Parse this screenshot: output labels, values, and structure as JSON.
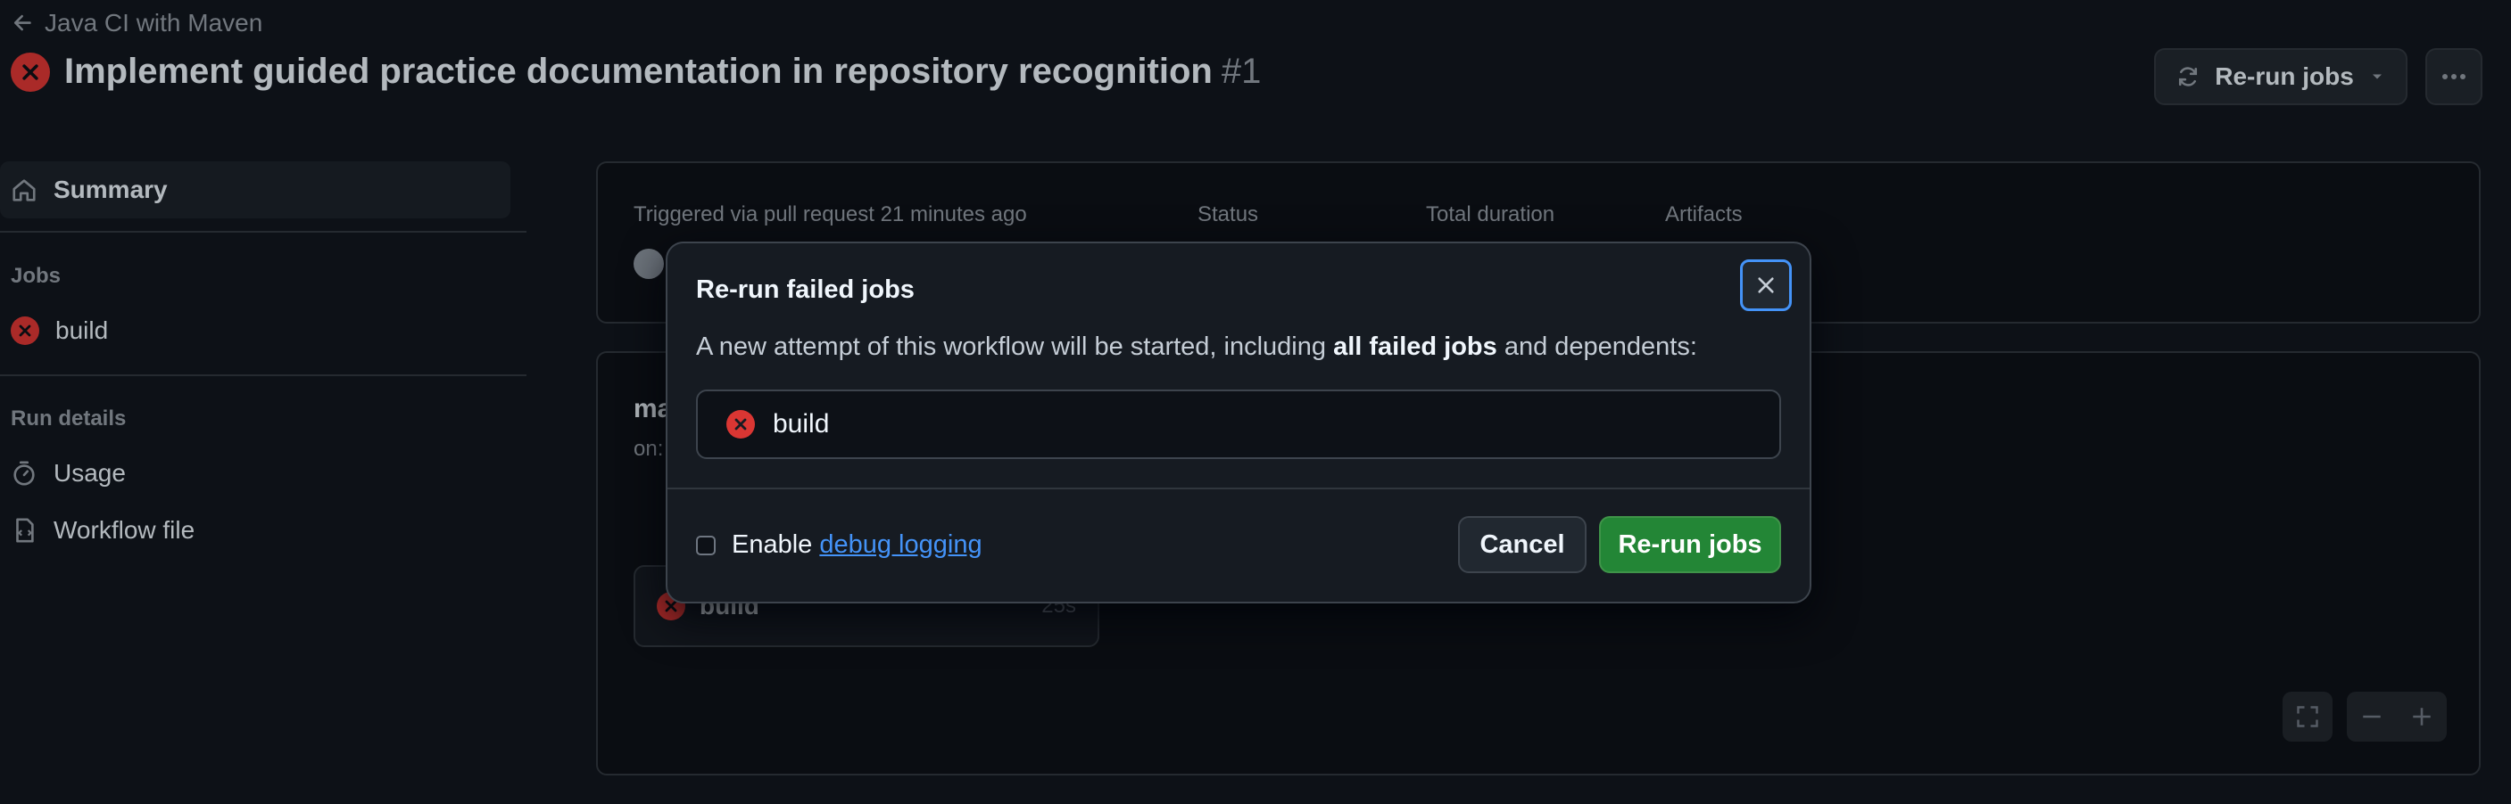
{
  "header": {
    "back_label": "Java CI with Maven",
    "title": "Implement guided practice documentation in repository recognition",
    "run_number": "#1",
    "rerun_label": "Re-run jobs"
  },
  "sidebar": {
    "summary_label": "Summary",
    "jobs_heading": "Jobs",
    "jobs": [
      {
        "label": "build",
        "status": "failed"
      }
    ],
    "run_details_heading": "Run details",
    "usage_label": "Usage",
    "workflow_file_label": "Workflow file"
  },
  "summary": {
    "triggered_label": "Triggered via pull request 21 minutes ago",
    "status_label": "Status",
    "duration_label": "Total duration",
    "artifacts_label": "Artifacts"
  },
  "workflow": {
    "name_partial": "ma",
    "on_partial": "on:",
    "job_name": "build",
    "job_duration": "25s"
  },
  "dialog": {
    "title": "Re-run failed jobs",
    "desc_prefix": "A new attempt of this workflow will be started, including ",
    "desc_bold": "all failed jobs",
    "desc_suffix": " and dependents:",
    "job_label": "build",
    "enable_label": "Enable ",
    "debug_link": "debug logging",
    "cancel_label": "Cancel",
    "rerun_label": "Re-run jobs"
  },
  "colors": {
    "background": "#0d1117",
    "failure": "#da3633",
    "primary_button": "#238636",
    "link": "#4493f8"
  }
}
